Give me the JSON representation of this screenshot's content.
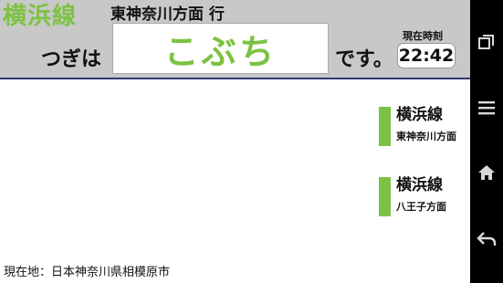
{
  "header": {
    "line_name": "横浜線",
    "direction": "東神奈川方面 行",
    "next_label": "つぎは",
    "station": "こぶち",
    "desu": "です。",
    "time_label": "現在時刻",
    "time": "22:42"
  },
  "routes": [
    {
      "name": "横浜線",
      "direction": "東神奈川方面"
    },
    {
      "name": "横浜線",
      "direction": "八王子方面"
    }
  ],
  "location": "現在地：日本神奈川県相模原市",
  "navbar": {
    "buttons": [
      "recent-apps-icon",
      "menu-icon",
      "home-icon",
      "back-icon"
    ]
  },
  "colors": {
    "accent": "#7cc242",
    "header_bg": "#c8c8c8",
    "rule": "#2b3a78"
  }
}
